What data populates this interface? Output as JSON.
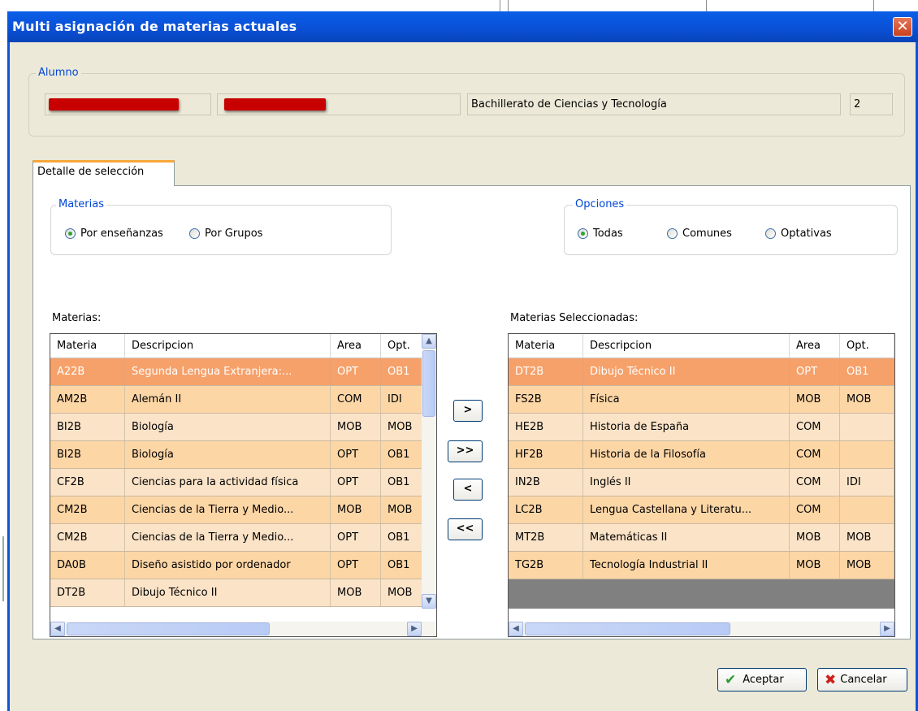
{
  "window": {
    "title": "Multi asignación de materias actuales",
    "close_label": "✕"
  },
  "alumno": {
    "legend": "Alumno",
    "name_field": "",
    "surname_field": "",
    "course": "Bachillerato de Ciencias y Tecnología",
    "year": "2"
  },
  "tab": {
    "label": "Detalle de selección"
  },
  "materias_group": {
    "legend": "Materias",
    "options": [
      {
        "label": "Por enseñanzas",
        "selected": true
      },
      {
        "label": "Por Grupos",
        "selected": false
      }
    ]
  },
  "opciones_group": {
    "legend": "Opciones",
    "options": [
      {
        "label": "Todas",
        "selected": true
      },
      {
        "label": "Comunes",
        "selected": false
      },
      {
        "label": "Optativas",
        "selected": false
      }
    ]
  },
  "left_list": {
    "label": "Materias:",
    "columns": [
      "Materia",
      "Descripcion",
      "Area",
      "Opt."
    ],
    "rows": [
      [
        "A22B",
        "Segunda Lengua Extranjera:...",
        "OPT",
        "OB1"
      ],
      [
        "AM2B",
        "Alemán II",
        "COM",
        "IDI"
      ],
      [
        "BI2B",
        "Biología",
        "MOB",
        "MOB"
      ],
      [
        "BI2B",
        "Biología",
        "OPT",
        "OB1"
      ],
      [
        "CF2B",
        "Ciencias para la actividad física",
        "OPT",
        "OB1"
      ],
      [
        "CM2B",
        "Ciencias de la Tierra y Medio...",
        "MOB",
        "MOB"
      ],
      [
        "CM2B",
        "Ciencias de la Tierra y Medio...",
        "OPT",
        "OB1"
      ],
      [
        "DA0B",
        "Diseño asistido por ordenador",
        "OPT",
        "OB1"
      ],
      [
        "DT2B",
        "Dibujo Técnico II",
        "MOB",
        "MOB"
      ]
    ],
    "selected_row": 0
  },
  "right_list": {
    "label": "Materias Seleccionadas:",
    "columns": [
      "Materia",
      "Descripcion",
      "Area",
      "Opt."
    ],
    "rows": [
      [
        "DT2B",
        "Dibujo Técnico II",
        "OPT",
        "OB1"
      ],
      [
        "FS2B",
        "Física",
        "MOB",
        "MOB"
      ],
      [
        "HE2B",
        "Historia de España",
        "COM",
        ""
      ],
      [
        "HF2B",
        "Historia de la Filosofía",
        "COM",
        ""
      ],
      [
        "IN2B",
        "Inglés II",
        "COM",
        "IDI"
      ],
      [
        "LC2B",
        "Lengua Castellana y Literatu...",
        "COM",
        ""
      ],
      [
        "MT2B",
        "Matemáticas II",
        "MOB",
        "MOB"
      ],
      [
        "TG2B",
        "Tecnología Industrial II",
        "MOB",
        "MOB"
      ]
    ],
    "selected_row": 0
  },
  "move_buttons": {
    "add_one": ">",
    "add_all": ">>",
    "remove_one": "<",
    "remove_all": "<<"
  },
  "footer": {
    "accept": "Aceptar",
    "cancel": "Cancelar"
  },
  "colors": {
    "title_bar": "#0a54dc",
    "selected_row": "#f6a16a",
    "row_light": "#fbe3c7",
    "row_dark": "#fdd6a6",
    "legend_text": "#0046d5"
  }
}
